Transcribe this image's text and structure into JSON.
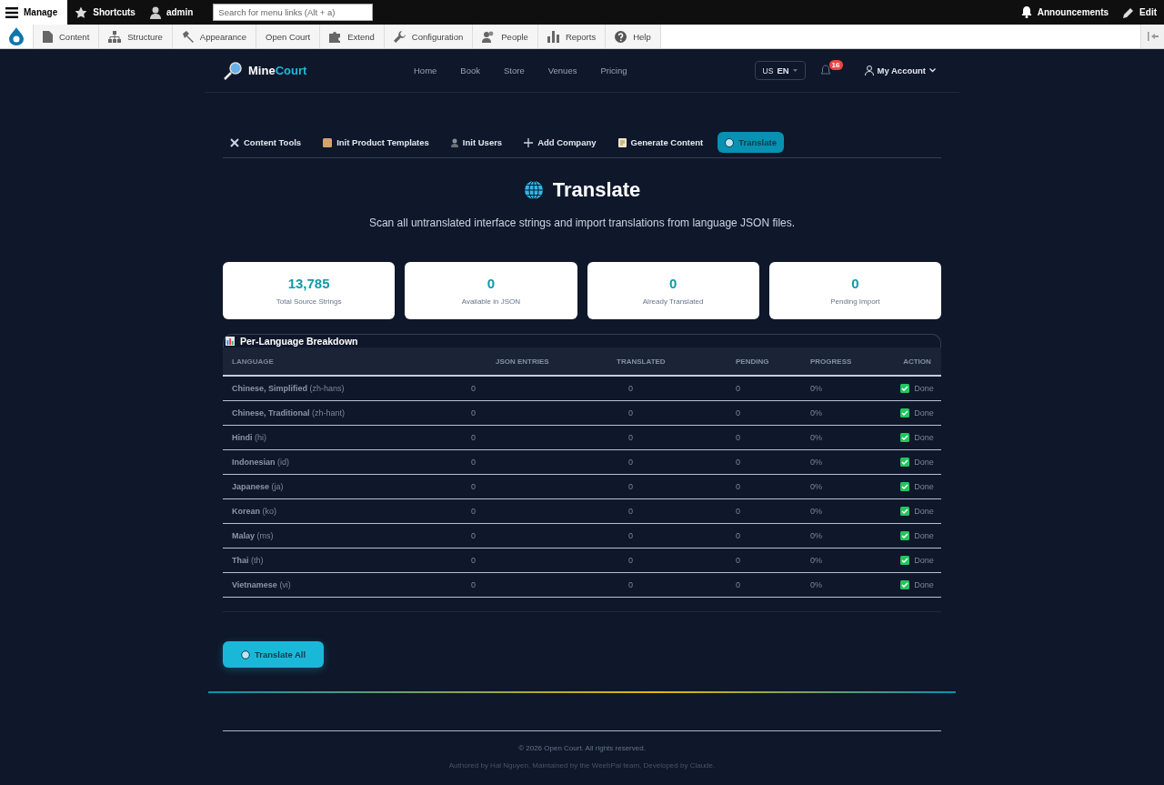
{
  "toolbar": {
    "manage": "Manage",
    "shortcuts": "Shortcuts",
    "user": "admin",
    "search": {
      "placeholder": "Search for menu links (Alt + a)"
    },
    "announcements": "Announcements",
    "edit": "Edit"
  },
  "admin_menu": [
    "Content",
    "Structure",
    "Appearance",
    "Open Court",
    "Extend",
    "Configuration",
    "People",
    "Reports",
    "Help"
  ],
  "site_header": {
    "logo_first": "Mine",
    "logo_second": "Court",
    "nav": [
      "Home",
      "Book",
      "Store",
      "Venues",
      "Pricing"
    ],
    "language_flag": "US",
    "language": "EN",
    "notification_count": "16",
    "account": "My Account"
  },
  "tool_tabs": [
    {
      "label": "Content Tools",
      "selected": false
    },
    {
      "label": "Init Product Templates",
      "selected": false
    },
    {
      "label": "Init Users",
      "selected": false
    },
    {
      "label": "Add Company",
      "selected": false
    },
    {
      "label": "Generate Content",
      "selected": false
    },
    {
      "label": "Translate",
      "selected": true
    }
  ],
  "page_title": "Translate",
  "description": "Scan all untranslated interface strings and import translations from language JSON files.",
  "stats": [
    {
      "value": "13,785",
      "label": "Total Source Strings"
    },
    {
      "value": "0",
      "label": "Available in JSON"
    },
    {
      "value": "0",
      "label": "Already Translated"
    },
    {
      "value": "0",
      "label": "Pending Import"
    }
  ],
  "breakdown": {
    "title": "Per-Language Breakdown",
    "columns": [
      "LANGUAGE",
      "JSON ENTRIES",
      "TRANSLATED",
      "PENDING",
      "PROGRESS",
      "ACTION"
    ],
    "rows": [
      {
        "language": "**Chinese, Simplified** (zh-hans)",
        "json_entries": "0",
        "translated": "0",
        "pending": "0",
        "progress": "0%",
        "action": "Done",
        "done": true
      },
      {
        "language": "**Chinese, Traditional** (zh-hant)",
        "json_entries": "0",
        "translated": "0",
        "pending": "0",
        "progress": "0%",
        "action": "Done",
        "done": true
      },
      {
        "language": "**Hindi** (hi)",
        "json_entries": "0",
        "translated": "0",
        "pending": "0",
        "progress": "0%",
        "action": "Done",
        "done": true
      },
      {
        "language": "**Indonesian** (id)",
        "json_entries": "0",
        "translated": "0",
        "pending": "0",
        "progress": "0%",
        "action": "Done",
        "done": true
      },
      {
        "language": "**Japanese** (ja)",
        "json_entries": "0",
        "translated": "0",
        "pending": "0",
        "progress": "0%",
        "action": "Done",
        "done": true
      },
      {
        "language": "**Korean** (ko)",
        "json_entries": "0",
        "translated": "0",
        "pending": "0",
        "progress": "0%",
        "action": "Done",
        "done": true
      },
      {
        "language": "**Malay** (ms)",
        "json_entries": "0",
        "translated": "0",
        "pending": "0",
        "progress": "0%",
        "action": "Done",
        "done": true
      },
      {
        "language": "**Thai** (th)",
        "json_entries": "0",
        "translated": "0",
        "pending": "0",
        "progress": "0%",
        "action": "Done",
        "done": true
      },
      {
        "language": "**Vietnamese** (vi)",
        "json_entries": "0",
        "translated": "0",
        "pending": "0",
        "progress": "0%",
        "action": "Done",
        "done": true
      }
    ]
  },
  "translate_all": "Translate All",
  "footer": {
    "copyright": "© 2026 Open Court. All rights reserved.",
    "credits": "Authored by Hai Nguyen, Maintained by the WeebPal team, Developed by Claude."
  }
}
